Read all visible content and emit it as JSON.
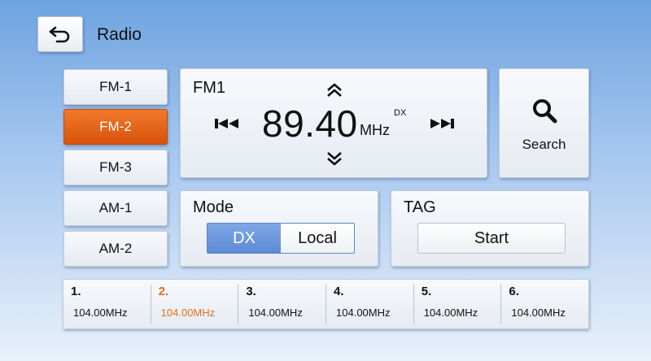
{
  "header": {
    "title": "Radio"
  },
  "bands": [
    {
      "label": "FM-1",
      "active": false
    },
    {
      "label": "FM-2",
      "active": true
    },
    {
      "label": "FM-3",
      "active": false
    },
    {
      "label": "AM-1",
      "active": false
    },
    {
      "label": "AM-2",
      "active": false
    }
  ],
  "tuner": {
    "band": "FM1",
    "frequency": "89.40",
    "unit": "MHz",
    "indicator": "DX"
  },
  "search": {
    "label": "Search"
  },
  "mode": {
    "label": "Mode",
    "options": [
      "DX",
      "Local"
    ],
    "selected": "DX"
  },
  "tag": {
    "label": "TAG",
    "button": "Start"
  },
  "presets": [
    {
      "num": "1.",
      "freq": "104.00MHz",
      "active": false
    },
    {
      "num": "2.",
      "freq": "104.00MHz",
      "active": true
    },
    {
      "num": "3.",
      "freq": "104.00MHz",
      "active": false
    },
    {
      "num": "4.",
      "freq": "104.00MHz",
      "active": false
    },
    {
      "num": "5.",
      "freq": "104.00MHz",
      "active": false
    },
    {
      "num": "6.",
      "freq": "104.00MHz",
      "active": false
    }
  ],
  "colors": {
    "accent": "#e3701e",
    "active_band": "#d8520c",
    "mode_selected": "#5c8ad6"
  }
}
